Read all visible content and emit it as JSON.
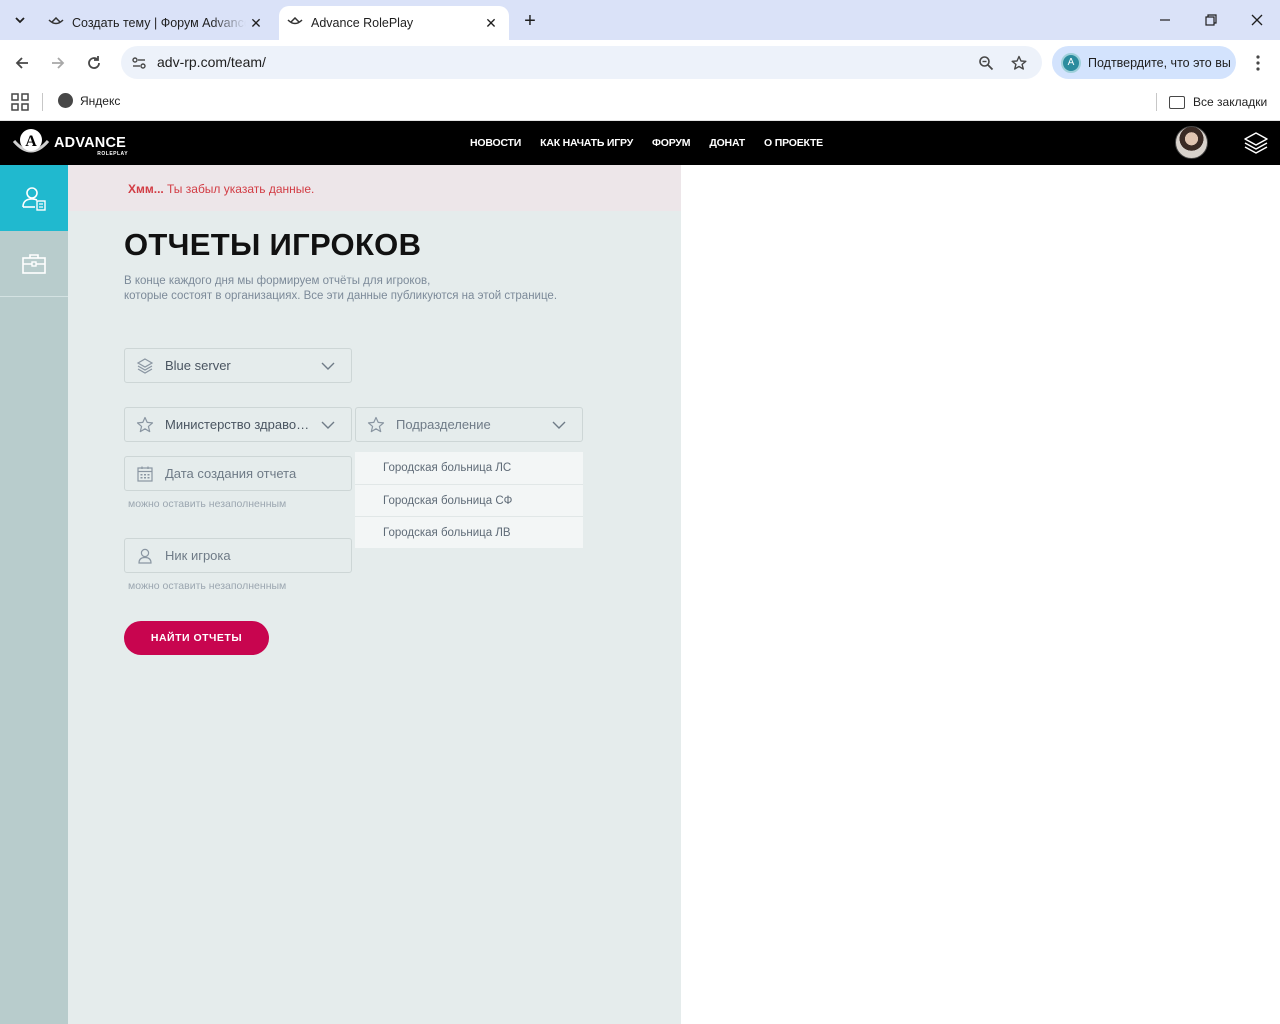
{
  "browser": {
    "tabs": [
      {
        "title": "Создать тему | Форум Advance RolePlay",
        "active": false
      },
      {
        "title": "Advance RolePlay",
        "active": true
      }
    ],
    "url": "adv-rp.com/team/",
    "profile_chip": "Подтвердите, что это вы",
    "profile_initial": "A",
    "bookmarks": [
      {
        "label": "Яндекс"
      }
    ],
    "all_bookmarks": "Все закладки"
  },
  "site": {
    "logo_text": "ADVANCE",
    "logo_sub": "ROLEPLAY",
    "nav": [
      "НОВОСТИ",
      "КАК НАЧАТЬ ИГРУ",
      "ФОРУМ",
      "ДОНАТ",
      "О ПРОЕКТЕ"
    ],
    "accent_color": "#20b9cf",
    "button_color": "#c8054f"
  },
  "alert": {
    "strong": "Хмм...",
    "message": "Ты забыл указать данные."
  },
  "page": {
    "title": "ОТЧЕТЫ ИГРОКОВ",
    "description_line1": "В конце каждого дня мы формируем отчёты для игроков,",
    "description_line2": "которые состоят в организациях. Все эти данные публикуются на этой странице."
  },
  "form": {
    "server": "Blue server",
    "organization": "Министерство здравоохранения",
    "division_placeholder": "Подразделение",
    "date_placeholder": "Дата создания отчета",
    "date_hint": "можно оставить незаполненным",
    "nick_placeholder": "Ник игрока",
    "nick_hint": "можно оставить незаполненным",
    "division_options": [
      "Городская больница ЛС",
      "Городская больница СФ",
      "Городская больница ЛВ"
    ],
    "submit": "НАЙТИ ОТЧЕТЫ"
  }
}
